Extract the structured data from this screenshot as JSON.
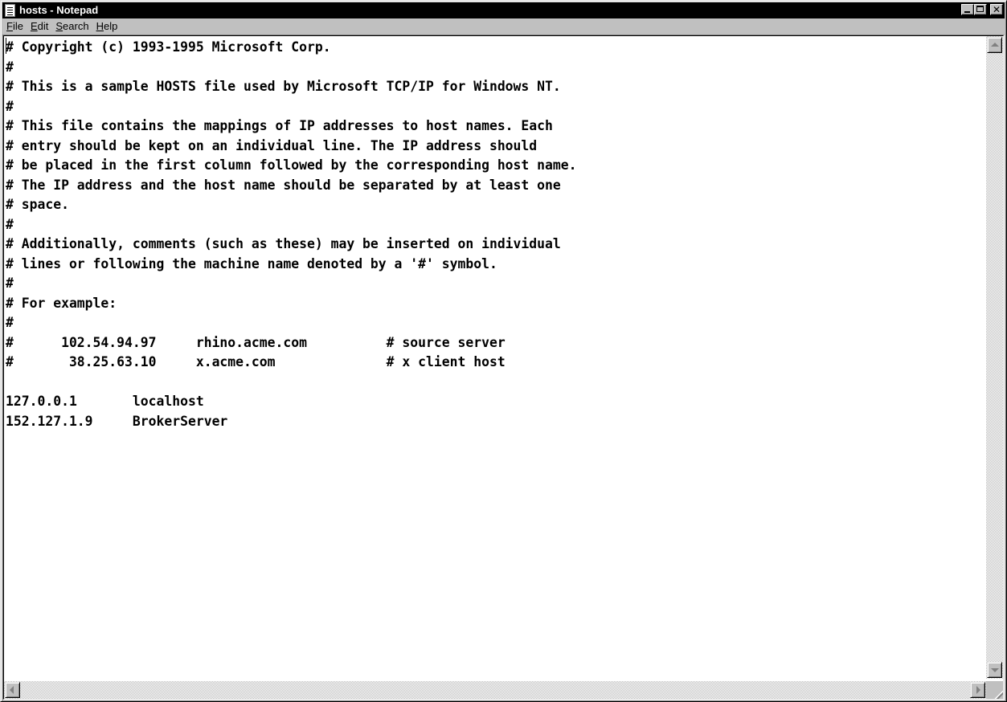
{
  "window": {
    "title": "hosts - Notepad",
    "icon": "notepad-icon",
    "controls": [
      "minimize-icon",
      "maximize-icon",
      "close-icon"
    ]
  },
  "menu": {
    "file": {
      "accel": "F",
      "rest": "ile"
    },
    "edit": {
      "accel": "E",
      "rest": "dit"
    },
    "search": {
      "accel": "S",
      "rest": "earch"
    },
    "help": {
      "accel": "H",
      "rest": "elp"
    }
  },
  "document": {
    "lines": [
      "# Copyright (c) 1993-1995 Microsoft Corp.",
      "#",
      "# This is a sample HOSTS file used by Microsoft TCP/IP for Windows NT.",
      "#",
      "# This file contains the mappings of IP addresses to host names. Each",
      "# entry should be kept on an individual line. The IP address should",
      "# be placed in the first column followed by the corresponding host name.",
      "# The IP address and the host name should be separated by at least one",
      "# space.",
      "#",
      "# Additionally, comments (such as these) may be inserted on individual",
      "# lines or following the machine name denoted by a '#' symbol.",
      "#",
      "# For example:",
      "#",
      "#      102.54.94.97     rhino.acme.com          # source server",
      "#       38.25.63.10     x.acme.com              # x client host",
      "",
      "127.0.0.1       localhost",
      "152.127.1.9     BrokerServer"
    ]
  },
  "colors": {
    "titlebar": "#000000",
    "title_text": "#ffffff",
    "chrome": "#c0c0c0",
    "editor_bg": "#ffffff"
  }
}
